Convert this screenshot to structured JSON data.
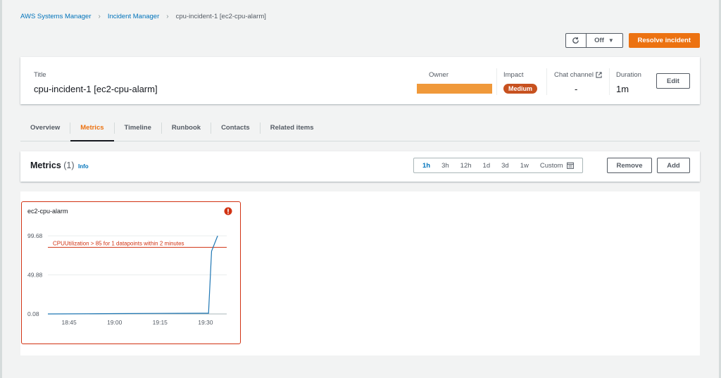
{
  "breadcrumb": {
    "items": [
      "AWS Systems Manager",
      "Incident Manager"
    ],
    "current": "cpu-incident-1 [ec2-cpu-alarm]"
  },
  "actions": {
    "refresh_icon": "refresh-icon",
    "auto_refresh": "Off",
    "resolve": "Resolve incident"
  },
  "summary": {
    "title_label": "Title",
    "title_value": "cpu-incident-1 [ec2-cpu-alarm]",
    "owner_label": "Owner",
    "impact_label": "Impact",
    "impact_value": "Medium",
    "chat_label": "Chat channel",
    "chat_value": "-",
    "duration_label": "Duration",
    "duration_value": "1m",
    "edit": "Edit"
  },
  "tabs": [
    {
      "label": "Overview",
      "active": false
    },
    {
      "label": "Metrics",
      "active": true
    },
    {
      "label": "Timeline",
      "active": false
    },
    {
      "label": "Runbook",
      "active": false
    },
    {
      "label": "Contacts",
      "active": false
    },
    {
      "label": "Related items",
      "active": false
    }
  ],
  "metrics": {
    "title": "Metrics",
    "count": "(1)",
    "info": "Info",
    "ranges": [
      "1h",
      "3h",
      "12h",
      "1d",
      "3d",
      "1w",
      "Custom"
    ],
    "active_range": "1h",
    "remove": "Remove",
    "add": "Add"
  },
  "colors": {
    "accent": "#ec7211",
    "alarm": "#d13212",
    "link": "#0073bb",
    "series": "#1f77b4",
    "impact": "#c7511f"
  },
  "chart_data": {
    "type": "line",
    "title": "ec2-cpu-alarm",
    "y_ticks": [
      "99.68",
      "49.88",
      "0.08"
    ],
    "ylim": [
      0.08,
      99.68
    ],
    "x_ticks": [
      "18:45",
      "19:00",
      "19:15",
      "19:30"
    ],
    "x_tick_minutes": [
      0,
      15,
      30,
      45
    ],
    "xlim_minutes": [
      -7,
      52
    ],
    "threshold": {
      "value": 85,
      "label": "CPUUtilization > 85 for 1 datapoints within 2 minutes"
    },
    "series": [
      {
        "x_minutes": [
          -7,
          0,
          15,
          30,
          44,
          46,
          47,
          49
        ],
        "y": [
          0.08,
          0.2,
          0.5,
          0.8,
          1.0,
          1.0,
          80,
          99.68
        ]
      }
    ],
    "grid": true
  }
}
